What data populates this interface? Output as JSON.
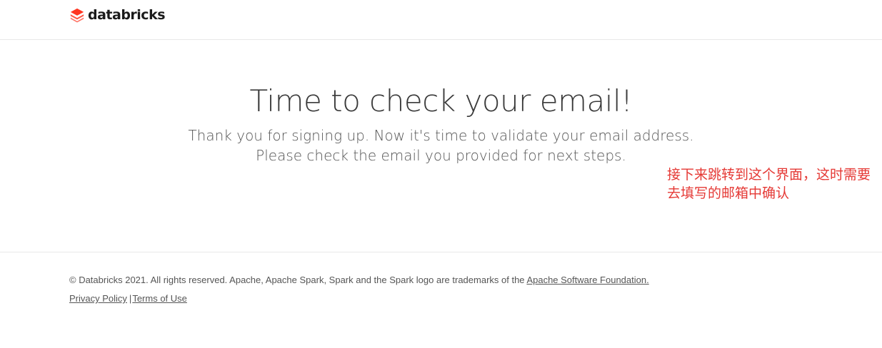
{
  "header": {
    "logo_text": "databricks",
    "logo_icon": "databricks-logo-icon",
    "brand_color": "#ff3621"
  },
  "hero": {
    "title": "Time to check your email!",
    "subtitle_line1": "Thank you for signing up. Now it's time to validate your email address.",
    "subtitle_line2": "Please check the email you provided for next steps."
  },
  "annotation": {
    "text": "接下来跳转到这个界面，这时需要去填写的邮箱中确认",
    "color": "#e53935"
  },
  "footer": {
    "copyright": "© Databricks 2021. All rights reserved. Apache, Apache Spark, Spark and the Spark logo are trademarks of the ",
    "asf_link": "Apache Software Foundation.",
    "privacy_link": "Privacy Policy",
    "separator": "|",
    "terms_link": "Terms of Use"
  }
}
